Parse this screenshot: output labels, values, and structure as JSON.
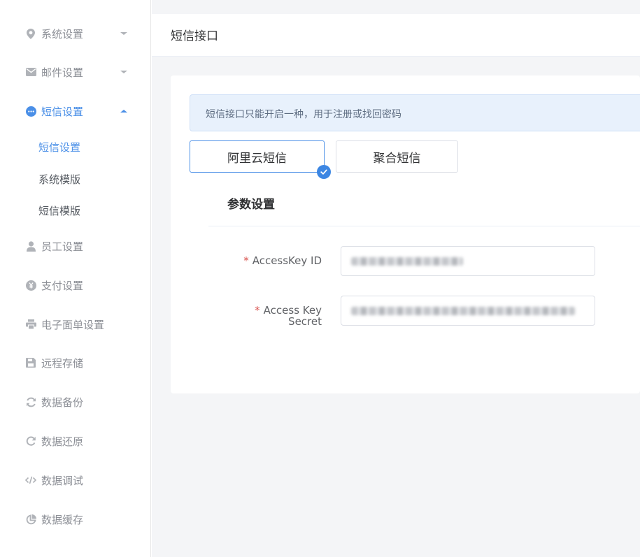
{
  "sidebar": {
    "items": [
      {
        "label": "系统设置",
        "icon": "map-pin-icon"
      },
      {
        "label": "邮件设置",
        "icon": "envelope-icon"
      },
      {
        "label": "短信设置",
        "icon": "chat-bubble-icon"
      },
      {
        "label": "员工设置",
        "icon": "user-icon"
      },
      {
        "label": "支付设置",
        "icon": "yen-coin-icon"
      },
      {
        "label": "电子面单设置",
        "icon": "printer-icon"
      },
      {
        "label": "远程存储",
        "icon": "floppy-disk-icon"
      },
      {
        "label": "数据备份",
        "icon": "sync-icon"
      },
      {
        "label": "数据还原",
        "icon": "redo-icon"
      },
      {
        "label": "数据调试",
        "icon": "code-icon"
      },
      {
        "label": "数据缓存",
        "icon": "pie-chart-icon"
      }
    ],
    "sub_items": [
      {
        "label": "短信设置"
      },
      {
        "label": "系统模版"
      },
      {
        "label": "短信模版"
      }
    ],
    "active_item": "短信设置",
    "active_sub_item": "短信设置"
  },
  "header": {
    "title": "短信接口"
  },
  "alert": {
    "text": "短信接口只能开启一种，用于注册或找回密码"
  },
  "providers": [
    {
      "label": "阿里云短信",
      "selected": true
    },
    {
      "label": "聚合短信",
      "selected": false
    }
  ],
  "section": {
    "title": "参数设置"
  },
  "form": {
    "required_mark": "*",
    "fields": [
      {
        "label": "AccessKey ID",
        "value_redacted": true
      },
      {
        "label_line1": "Access Key",
        "label_line2": "Secret",
        "value_redacted": true
      }
    ]
  },
  "colors": {
    "accent": "#4a8fe7",
    "sidebar_text": "#8c8f96",
    "alert_bg": "#e8f1fc",
    "page_bg": "#f4f5f7",
    "required": "#d9534f"
  }
}
